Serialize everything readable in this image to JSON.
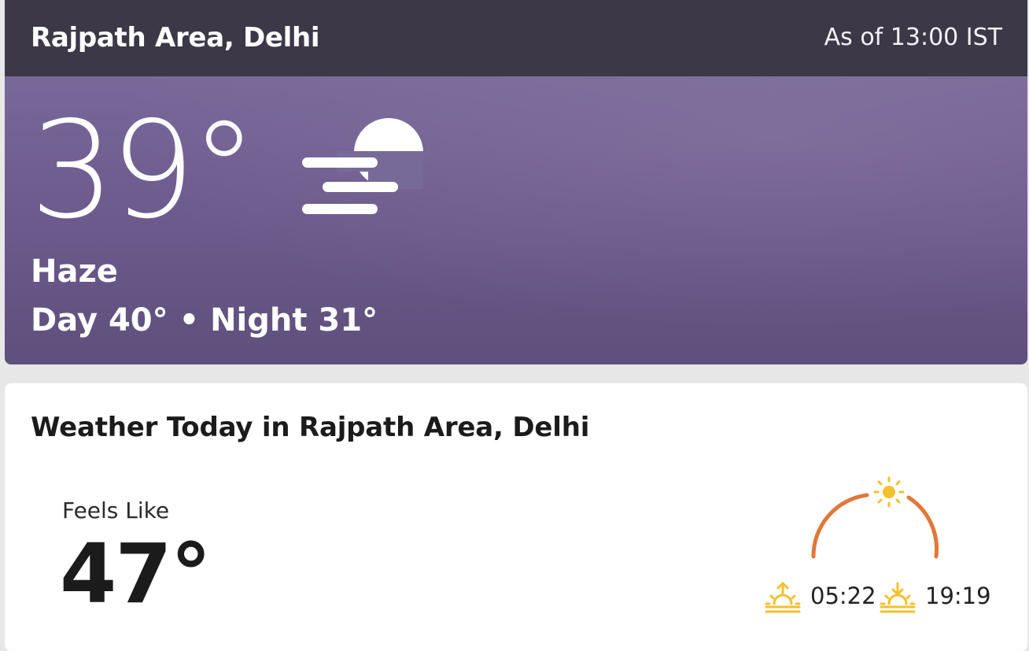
{
  "current": {
    "location": "Rajpath Area, Delhi",
    "as_of": "As of 13:00 IST",
    "temperature": "39°",
    "condition": "Haze",
    "condition_icon": "haze-icon",
    "day": "Day 40°",
    "separator": " • ",
    "night": "Night 31°"
  },
  "today": {
    "title": "Weather Today in Rajpath Area, Delhi",
    "feels_like_label": "Feels Like",
    "feels_like_value": "47°",
    "sunrise": "05:22",
    "sunset": "19:19",
    "sun_position_fraction": 0.5
  },
  "colors": {
    "header_bg": "#3c3848",
    "hero_bg": "#715f92",
    "arc": "#e2773a",
    "sun": "#f2c12e"
  }
}
